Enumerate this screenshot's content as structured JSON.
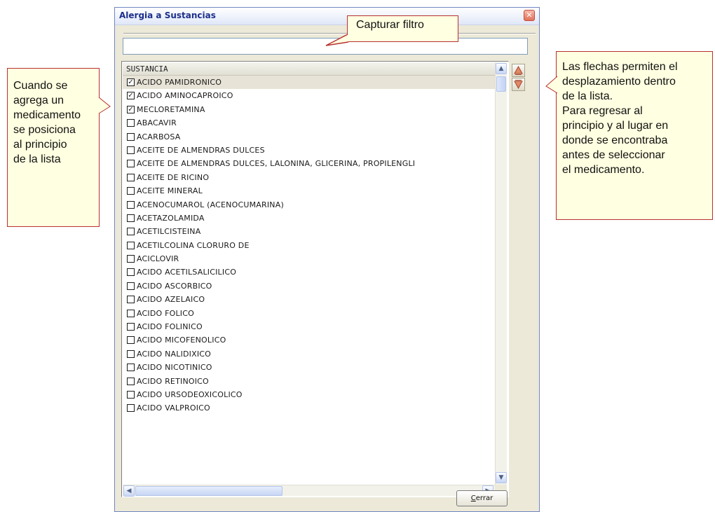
{
  "window": {
    "title": "Alergia a Sustancias",
    "close_glyph": "✕"
  },
  "filter": {
    "value": "",
    "placeholder": ""
  },
  "list": {
    "column_header": "SUSTANCIA",
    "items": [
      {
        "label": "ACIDO PAMIDRONICO",
        "checked": true,
        "selected": true
      },
      {
        "label": "ACIDO AMINOCAPROICO",
        "checked": true
      },
      {
        "label": "MECLORETAMINA",
        "checked": true
      },
      {
        "label": "ABACAVIR",
        "checked": false
      },
      {
        "label": "ACARBOSA",
        "checked": false
      },
      {
        "label": "ACEITE DE ALMENDRAS DULCES",
        "checked": false
      },
      {
        "label": "ACEITE DE ALMENDRAS DULCES, LALONINA, GLICERINA, PROPILENGLI",
        "checked": false
      },
      {
        "label": "ACEITE DE RICINO",
        "checked": false
      },
      {
        "label": "ACEITE MINERAL",
        "checked": false
      },
      {
        "label": "ACENOCUMAROL (ACENOCUMARINA)",
        "checked": false
      },
      {
        "label": "ACETAZOLAMIDA",
        "checked": false
      },
      {
        "label": "ACETILCISTEINA",
        "checked": false
      },
      {
        "label": "ACETILCOLINA CLORURO DE",
        "checked": false
      },
      {
        "label": "ACICLOVIR",
        "checked": false
      },
      {
        "label": "ACIDO ACETILSALICILICO",
        "checked": false
      },
      {
        "label": "ACIDO ASCORBICO",
        "checked": false
      },
      {
        "label": "ACIDO AZELAICO",
        "checked": false
      },
      {
        "label": "ACIDO FOLICO",
        "checked": false
      },
      {
        "label": "ACIDO FOLINICO",
        "checked": false
      },
      {
        "label": "ACIDO MICOFENOLICO",
        "checked": false
      },
      {
        "label": "ACIDO NALIDIXICO",
        "checked": false
      },
      {
        "label": "ACIDO NICOTINICO",
        "checked": false
      },
      {
        "label": "ACIDO RETINOICO",
        "checked": false
      },
      {
        "label": "ACIDO URSODEOXICOLICO",
        "checked": false
      },
      {
        "label": "ACIDO VALPROICO",
        "checked": false
      }
    ],
    "check_glyph": "✓"
  },
  "scroll": {
    "up_glyph": "▲",
    "down_glyph": "▼",
    "left_glyph": "◀",
    "right_glyph": "▶"
  },
  "buttons": {
    "close_accel": "C",
    "close_rest": "errar"
  },
  "callouts": {
    "filter": "Capturar filtro",
    "left": "Cuando se\nagrega un\nmedicamento\nse posiciona\nal principio\nde la lista",
    "right": "Las flechas permiten el\ndesplazamiento dentro\nde la lista.\nPara regresar al\nprincipio y al lugar en\ndonde se encontraba\nantes de seleccionar\nel medicamento."
  },
  "colors": {
    "callout_bg": "#ffffe1",
    "callout_border": "#b83030",
    "title_text": "#1c2f8c",
    "window_bg": "#ece9d8"
  }
}
